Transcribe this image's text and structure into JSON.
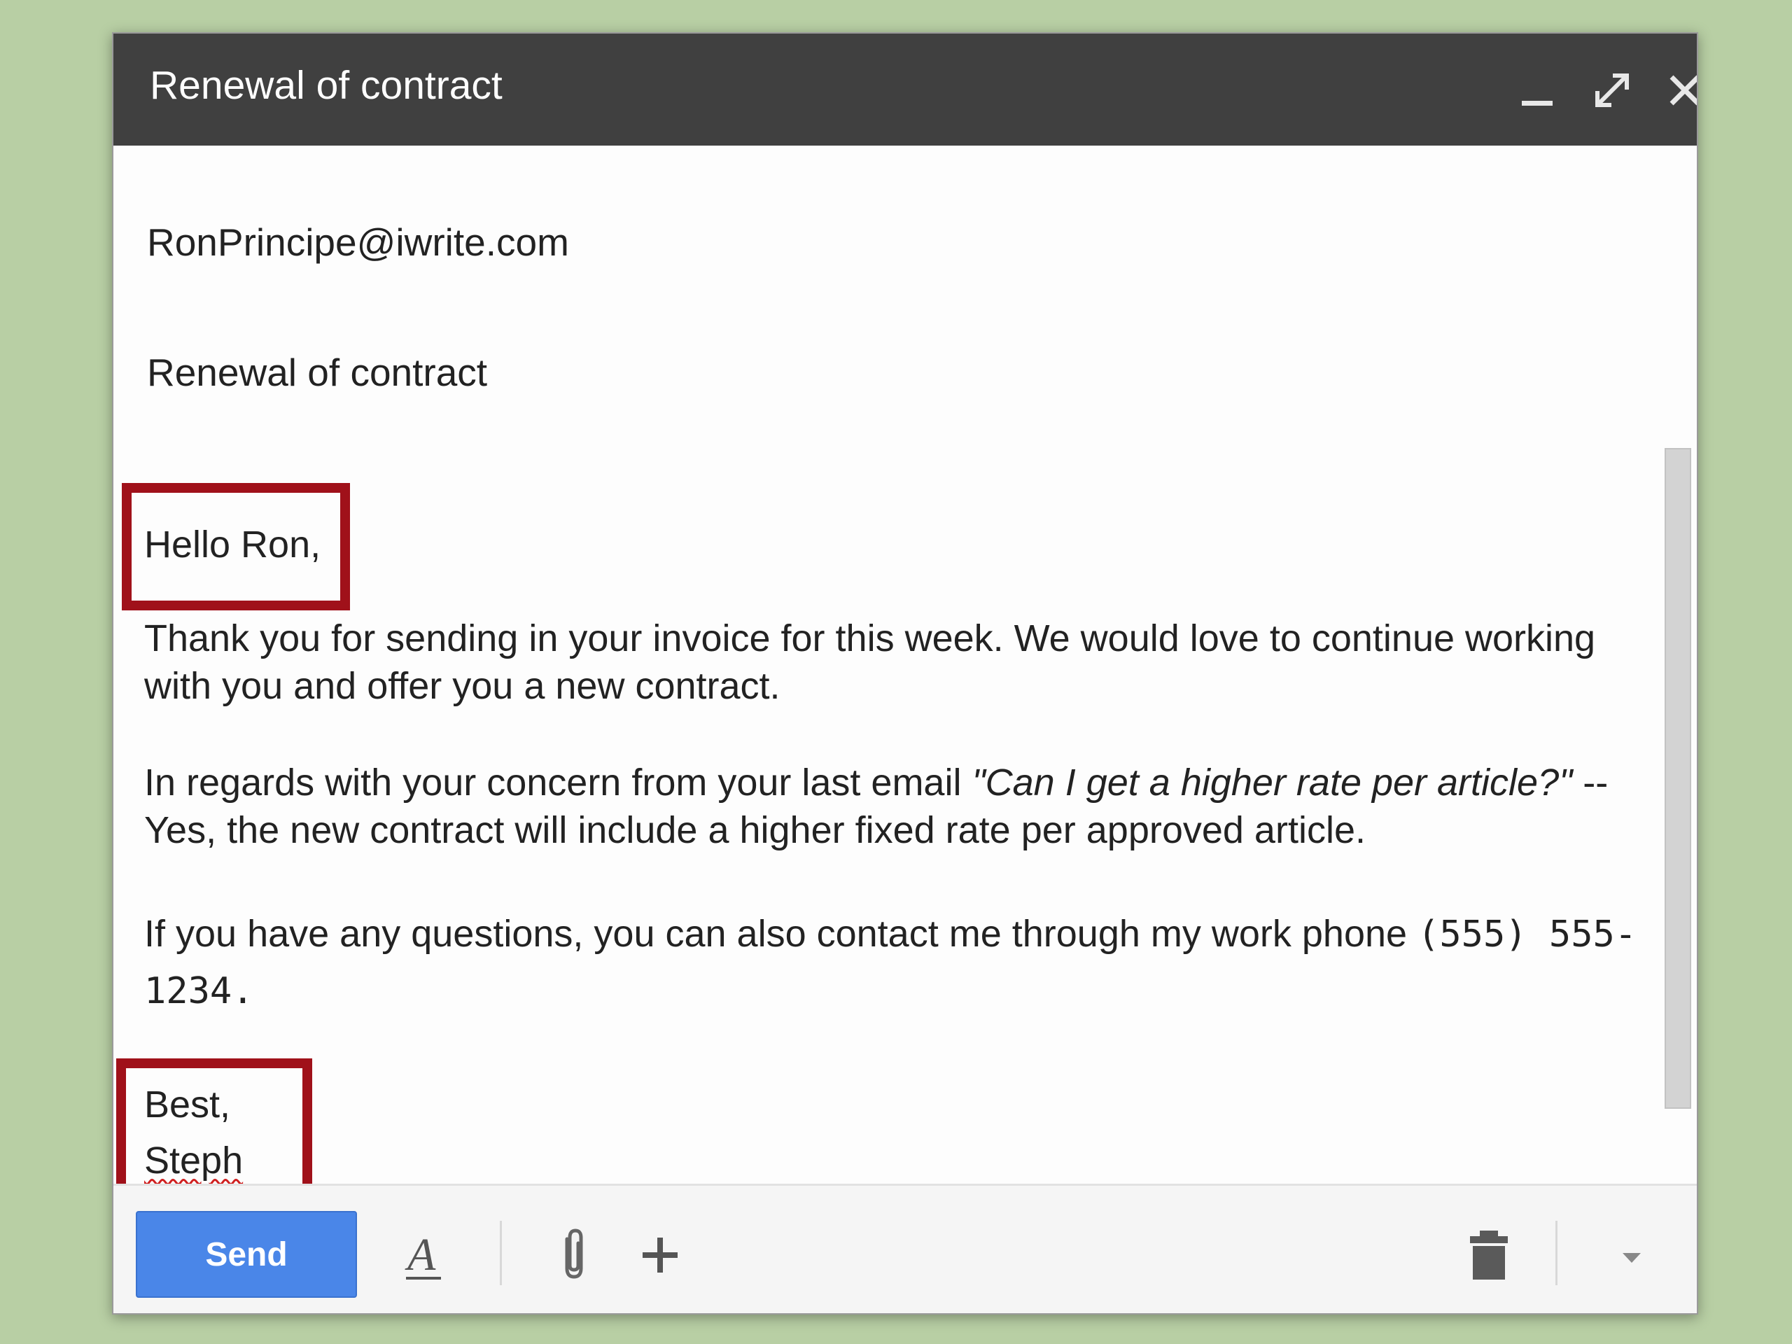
{
  "window": {
    "title": "Renewal of contract",
    "minimize_icon": "minimize-icon",
    "expand_icon": "expand-icon",
    "close_icon": "close-icon"
  },
  "fields": {
    "to": "RonPrincipe@iwrite.com",
    "subject": "Renewal of contract"
  },
  "message": {
    "greeting": "Hello Ron,",
    "para1": "Thank you for sending in your invoice for this week. We would love to continue working with you and offer you a new contract.",
    "para2_prefix": "In regards with your concern from your last email ",
    "para2_quote": "\"Can I get a higher rate per article?\"",
    "para2_suffix": " -- Yes, the new contract will include a higher fixed rate per approved article.",
    "para3_prefix": "If you have any questions, you can also contact me through my work phone ",
    "para3_phone": "(555) 555-1234.",
    "signoff": "Best,",
    "signature": "Steph"
  },
  "toolbar": {
    "send_label": "Send",
    "formatting_icon": "text-format-icon",
    "attach_icon": "paperclip-icon",
    "more_icon": "plus-icon",
    "discard_icon": "trash-icon",
    "options_icon": "caret-down-icon"
  },
  "colors": {
    "titlebar": "#404040",
    "send_button": "#4a86e8",
    "highlight": "#a0111a",
    "background": "#b8cfa4"
  }
}
